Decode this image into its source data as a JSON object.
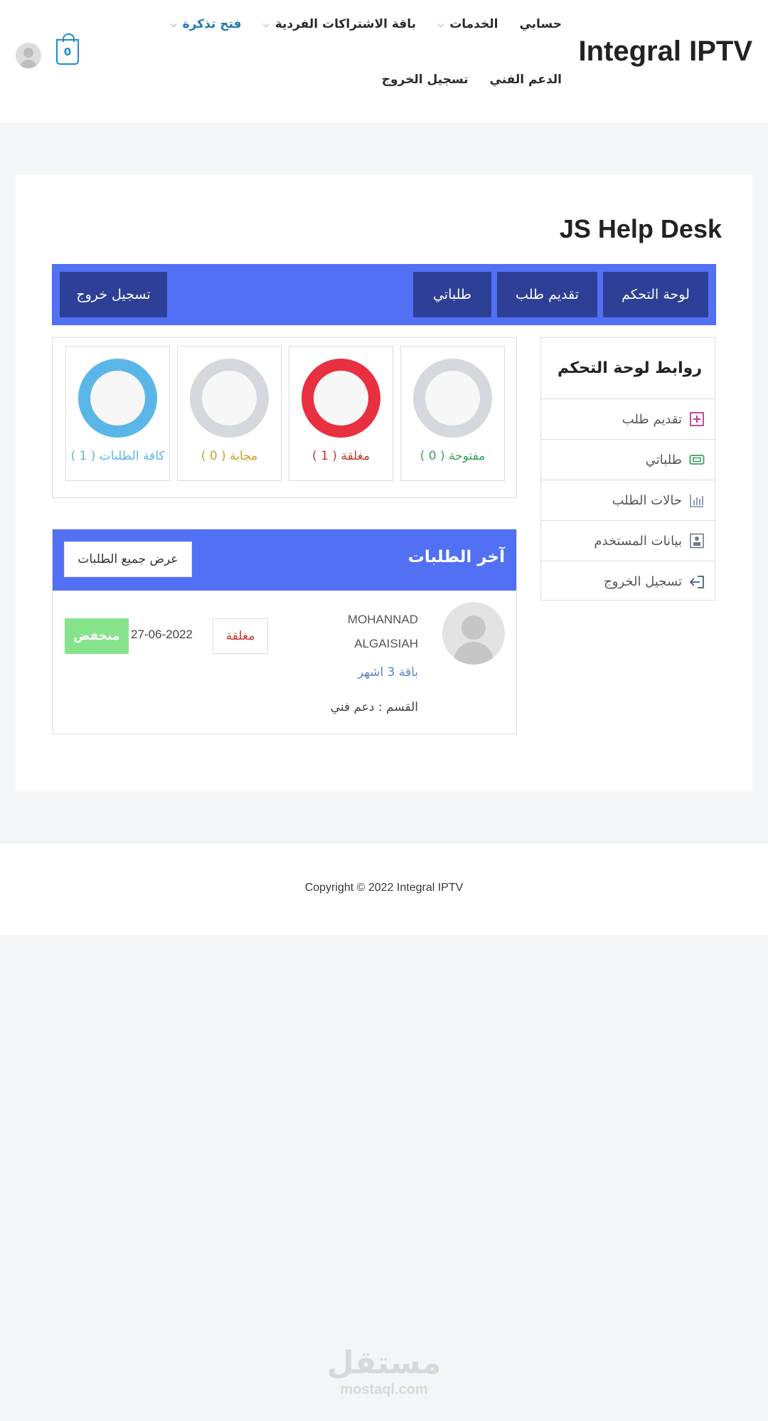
{
  "header": {
    "brand": "Integral IPTV",
    "nav_row1": [
      {
        "label": "حسابي",
        "dropdown": false,
        "active": false
      },
      {
        "label": "الخدمات",
        "dropdown": true,
        "active": false
      },
      {
        "label": "باقة الاشتراكات الفردية",
        "dropdown": true,
        "active": false
      },
      {
        "label": "فتح تذكرة",
        "dropdown": true,
        "active": true
      }
    ],
    "nav_row2": [
      {
        "label": "الدعم الفني"
      },
      {
        "label": "تسجيل الخروج"
      }
    ],
    "cart_count": "0"
  },
  "page": {
    "title": "JS Help Desk"
  },
  "toolbar": {
    "dashboard": "لوحة التحكم",
    "submit_ticket": "تقديم طلب",
    "my_tickets": "طلباتي",
    "logout": "تسجيل خروج"
  },
  "links": {
    "title": "روابط لوحة التحكم",
    "items": [
      {
        "label": "تقديم طلب",
        "icon": "plus-square-icon",
        "color": "#c2398f"
      },
      {
        "label": "طلباتي",
        "icon": "ticket-icon",
        "color": "#3aa35b"
      },
      {
        "label": "حالات الطلب",
        "icon": "bar-chart-icon",
        "color": "#7a8aa6"
      },
      {
        "label": "بيانات المستخدم",
        "icon": "user-card-icon",
        "color": "#6f7b8a"
      },
      {
        "label": "تسجيل الخروج",
        "icon": "logout-icon",
        "color": "#4a5e80"
      }
    ]
  },
  "stats": [
    {
      "label": "مفتوحة ( 0 )",
      "count": 0,
      "color": "#3aa35b"
    },
    {
      "label": "مغلقة ( 1 )",
      "count": 1,
      "color": "#e83040"
    },
    {
      "label": "مجابة ( 0 )",
      "count": 0,
      "color": "#c9a227"
    },
    {
      "label": "كافة الطلبات ( 1 )",
      "count": 1,
      "color": "#5bb6e8"
    }
  ],
  "latest": {
    "title": "آخر الطلبات",
    "view_all": "عرض جميع الطلبات",
    "request": {
      "name_line1": "MOHANNAD",
      "name_line2": "ALGAISIAH",
      "package": "باقة 3 اشهر",
      "department": "القسم : دعم فني",
      "status": "مغلقة",
      "date": "27-06-2022",
      "priority": "منخفض"
    }
  },
  "footer": {
    "copyright": "Copyright © 2022 Integral IPTV"
  },
  "watermark": {
    "arabic": "مستقل",
    "latin": "mostaql.com"
  }
}
